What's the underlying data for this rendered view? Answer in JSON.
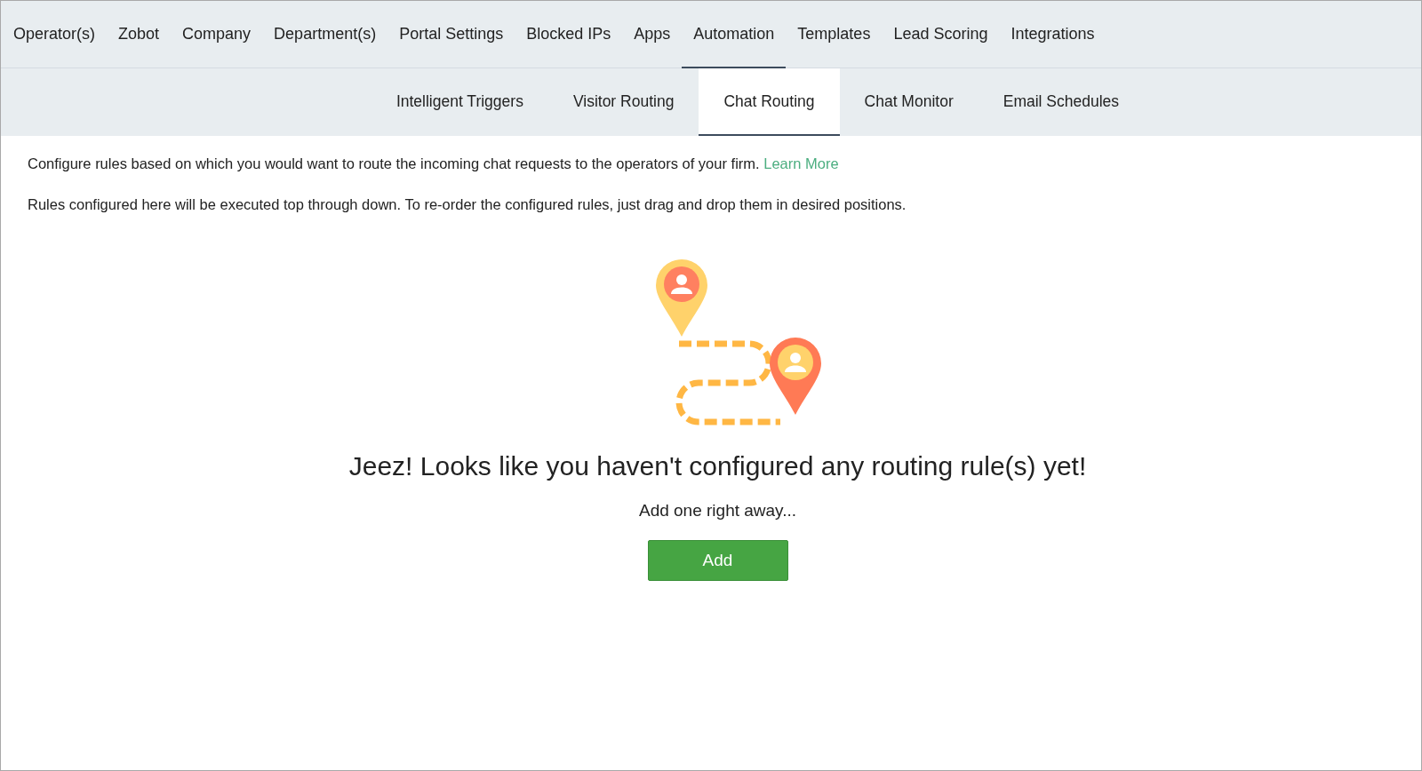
{
  "main_tabs": [
    {
      "label": "Operator(s)",
      "selected": false
    },
    {
      "label": "Zobot",
      "selected": false
    },
    {
      "label": "Company",
      "selected": false
    },
    {
      "label": "Department(s)",
      "selected": false
    },
    {
      "label": "Portal Settings",
      "selected": false
    },
    {
      "label": "Blocked IPs",
      "selected": false
    },
    {
      "label": "Apps",
      "selected": false
    },
    {
      "label": "Automation",
      "selected": true
    },
    {
      "label": "Templates",
      "selected": false
    },
    {
      "label": "Lead Scoring",
      "selected": false
    },
    {
      "label": "Integrations",
      "selected": false
    }
  ],
  "sub_tabs": [
    {
      "label": "Intelligent Triggers",
      "selected": false
    },
    {
      "label": "Visitor Routing",
      "selected": false
    },
    {
      "label": "Chat Routing",
      "selected": true
    },
    {
      "label": "Chat Monitor",
      "selected": false
    },
    {
      "label": "Email Schedules",
      "selected": false
    }
  ],
  "description": {
    "text": "Configure rules based on which you would want to route the incoming chat requests to the operators of your firm.",
    "link": "Learn More"
  },
  "note": "Rules configured here will be executed top through down. To re-order the configured rules, just drag and drop them in desired positions.",
  "empty_state": {
    "heading": "Jeez! Looks like you haven't configured any routing rule(s) yet!",
    "subtext": "Add one right away...",
    "button": "Add"
  }
}
